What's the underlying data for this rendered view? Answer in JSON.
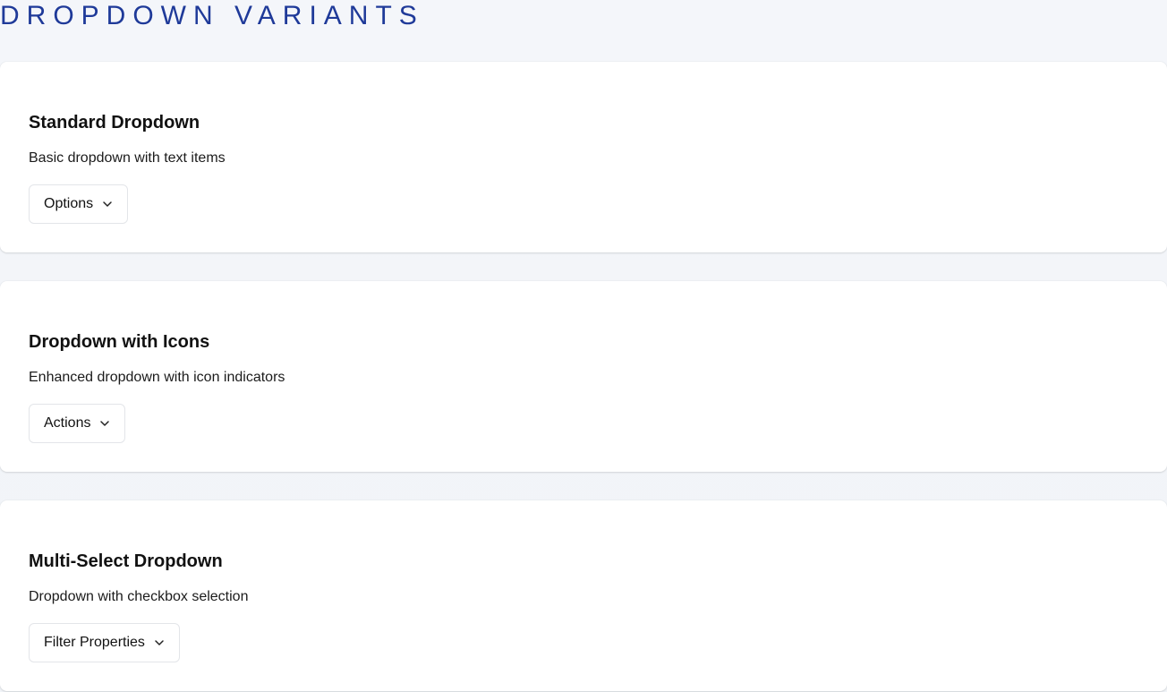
{
  "page": {
    "title": "DROPDOWN VARIANTS",
    "accent_color": "#1f3a99"
  },
  "sections": [
    {
      "title": "Standard Dropdown",
      "description": "Basic dropdown with text items",
      "trigger_label": "Options",
      "trigger_icon": "chevron-down-icon"
    },
    {
      "title": "Dropdown with Icons",
      "description": "Enhanced dropdown with icon indicators",
      "trigger_label": "Actions",
      "trigger_icon": "chevron-down-icon"
    },
    {
      "title": "Multi-Select Dropdown",
      "description": "Dropdown with checkbox selection",
      "trigger_label": "Filter Properties",
      "trigger_icon": "chevron-down-icon"
    }
  ]
}
